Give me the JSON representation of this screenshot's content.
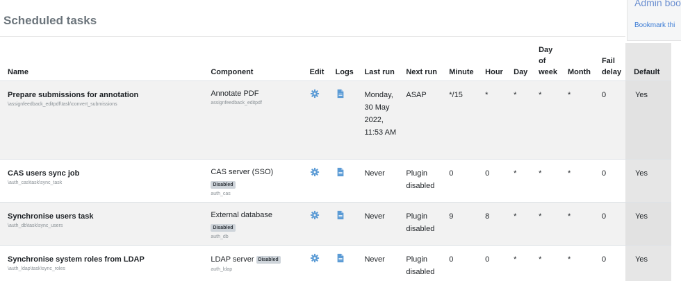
{
  "page": {
    "title": "Scheduled tasks"
  },
  "side_panel": {
    "link1": "Admin boo",
    "link2": "Bookmark thi"
  },
  "table": {
    "headers": {
      "name": "Name",
      "component": "Component",
      "edit": "Edit",
      "logs": "Logs",
      "last_run": "Last run",
      "next_run": "Next run",
      "minute": "Minute",
      "hour": "Hour",
      "day": "Day",
      "day_of_week": "Day of week",
      "month": "Month",
      "fail_delay": "Fail delay",
      "default": "Default"
    },
    "rows": [
      {
        "name": "Prepare submissions for annotation",
        "classname": "\\assignfeedback_editpdf\\task\\convert_submissions",
        "component": "Annotate PDF",
        "component_badge": "",
        "component_sub": "assignfeedback_editpdf",
        "last_run": "Monday, 30 May 2022, 11:53 AM",
        "next_run": "ASAP",
        "minute": "*/15",
        "hour": "*",
        "day": "*",
        "day_of_week": "*",
        "month": "*",
        "fail_delay": "0",
        "default": "Yes"
      },
      {
        "name": "CAS users sync job",
        "classname": "\\auth_cas\\task\\sync_task",
        "component": "CAS server (SSO)",
        "component_badge": "Disabled",
        "component_sub": "auth_cas",
        "last_run": "Never",
        "next_run": "Plugin disabled",
        "minute": "0",
        "hour": "0",
        "day": "*",
        "day_of_week": "*",
        "month": "*",
        "fail_delay": "0",
        "default": "Yes"
      },
      {
        "name": "Synchronise users task",
        "classname": "\\auth_db\\task\\sync_users",
        "component": "External database",
        "component_badge": "Disabled",
        "component_sub": "auth_db",
        "last_run": "Never",
        "next_run": "Plugin disabled",
        "minute": "9",
        "hour": "8",
        "day": "*",
        "day_of_week": "*",
        "month": "*",
        "fail_delay": "0",
        "default": "Yes"
      },
      {
        "name": "Synchronise system roles from LDAP",
        "classname": "\\auth_ldap\\task\\sync_roles",
        "component": "LDAP server",
        "component_badge": "Disabled",
        "component_sub": "auth_ldap",
        "last_run": "Never",
        "next_run": "Plugin disabled",
        "minute": "0",
        "hour": "0",
        "day": "*",
        "day_of_week": "*",
        "month": "*",
        "fail_delay": "0",
        "default": "Yes"
      }
    ]
  },
  "icons": {
    "edit": "gear-icon",
    "logs": "file-icon"
  },
  "colors": {
    "icon": "#5b9bd5",
    "title": "#6b747b",
    "badge": "#ced4da"
  }
}
